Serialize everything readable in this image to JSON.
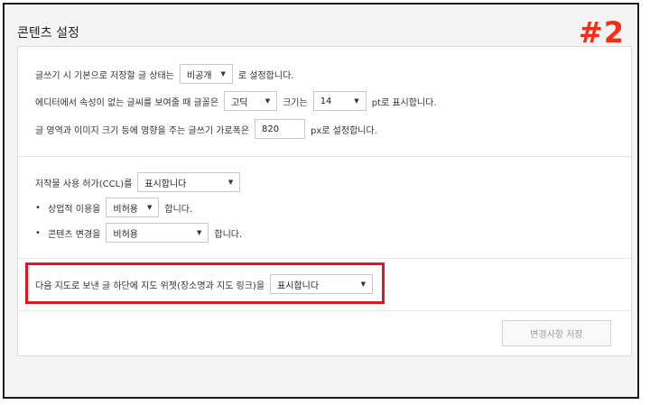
{
  "page": {
    "title": "콘텐츠 설정",
    "badge": "#2"
  },
  "editor": {
    "default_state_prefix": "글쓰기 시 기본으로 저장할 글 상태는",
    "default_state_value": "비공개",
    "default_state_suffix": "로 설정합니다.",
    "font_prefix": "에디터에서 속성이 없는 글씨를 보여줄 때 글꼴은",
    "font_value": "고딕",
    "size_label": "크기는",
    "size_value": "14",
    "size_suffix": "pt로 표시합니다.",
    "width_prefix": "글 영역과 이미지 크기 등에 영향을 주는 글쓰기 가로폭은",
    "width_value": "820",
    "width_suffix": "px로 설정합니다."
  },
  "ccl": {
    "label": "저작물 사용 허가(CCL)를",
    "value": "표시합니다",
    "commercial_bullet": "•",
    "commercial_label": "상업적 이용을",
    "commercial_value": "비허용",
    "commercial_suffix": "합니다.",
    "modify_bullet": "•",
    "modify_label": "콘텐츠 변경을",
    "modify_value": "비허용",
    "modify_suffix": "합니다."
  },
  "map": {
    "label": "다음 지도로 보낸 글 하단에 지도 위젯(장소명과 지도 링크)을",
    "value": "표시합니다"
  },
  "actions": {
    "save_label": "변경사항 저장"
  },
  "colors": {
    "highlight": "#e5141f",
    "badge": "#ff2a12"
  }
}
